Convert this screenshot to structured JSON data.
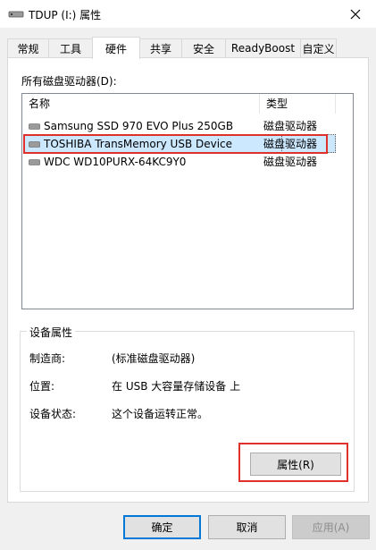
{
  "window": {
    "title": "TDUP (I:) 属性",
    "close_glyph": "✕"
  },
  "tabs": [
    {
      "label": "常规"
    },
    {
      "label": "工具"
    },
    {
      "label": "硬件"
    },
    {
      "label": "共享"
    },
    {
      "label": "安全"
    },
    {
      "label": "ReadyBoost"
    },
    {
      "label": "自定义"
    }
  ],
  "active_tab": "硬件",
  "drives_list": {
    "title": "所有磁盘驱动器(D):",
    "columns": {
      "name": "名称",
      "type": "类型"
    },
    "rows": [
      {
        "name": "Samsung SSD 970 EVO Plus 250GB",
        "type": "磁盘驱动器"
      },
      {
        "name": "TOSHIBA TransMemory USB Device",
        "type": "磁盘驱动器"
      },
      {
        "name": "WDC WD10PURX-64KC9Y0",
        "type": "磁盘驱动器"
      }
    ],
    "selected_index": 1
  },
  "device_properties": {
    "group_title": "设备属性",
    "manufacturer_label": "制造商:",
    "manufacturer_value": "(标准磁盘驱动器)",
    "location_label": "位置:",
    "location_value": "在 USB 大容量存储设备 上",
    "status_label": "设备状态:",
    "status_value": "这个设备运转正常。"
  },
  "buttons": {
    "properties": "属性(R)",
    "ok": "确定",
    "cancel": "取消",
    "apply": "应用(A)"
  },
  "colors": {
    "selection": "#cce8ff",
    "annotation_red": "#e0302c",
    "default_button_border": "#0078d7"
  }
}
